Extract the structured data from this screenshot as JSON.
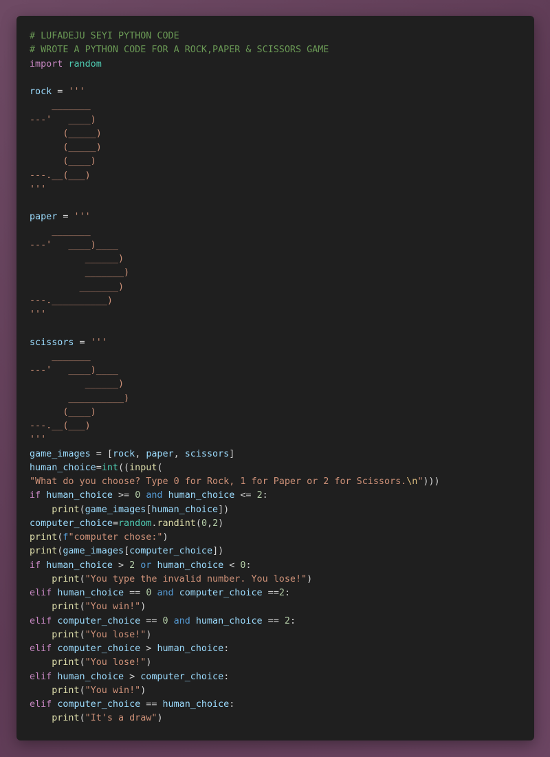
{
  "colors": {
    "background": "#6e4a64",
    "editor": "#1f1f1f",
    "comment": "#6a9955",
    "keyword": "#c586c0",
    "module": "#4ec9b0",
    "variable": "#9cdcfe",
    "string": "#ce9178",
    "number": "#b5cea8",
    "function": "#dcdcaa",
    "logic_keyword": "#569cd6"
  },
  "code": {
    "lines": [
      [
        {
          "t": "cm",
          "v": "# LUFADEJU SEYI PYTHON CODE"
        }
      ],
      [
        {
          "t": "cm",
          "v": "# WROTE A PYTHON CODE FOR A ROCK,PAPER & SCISSORS GAME"
        }
      ],
      [
        {
          "t": "kw",
          "v": "import"
        },
        {
          "t": "op",
          "v": " "
        },
        {
          "t": "mod",
          "v": "random"
        }
      ],
      [],
      [
        {
          "t": "var",
          "v": "rock"
        },
        {
          "t": "op",
          "v": " = "
        },
        {
          "t": "str",
          "v": "'''"
        }
      ],
      [
        {
          "t": "str",
          "v": "    _______"
        }
      ],
      [
        {
          "t": "str",
          "v": "---'   ____)"
        }
      ],
      [
        {
          "t": "str",
          "v": "      (_____)"
        }
      ],
      [
        {
          "t": "str",
          "v": "      (_____)"
        }
      ],
      [
        {
          "t": "str",
          "v": "      (____)"
        }
      ],
      [
        {
          "t": "str",
          "v": "---.__(___)"
        }
      ],
      [
        {
          "t": "str",
          "v": "'''"
        }
      ],
      [],
      [
        {
          "t": "var",
          "v": "paper"
        },
        {
          "t": "op",
          "v": " = "
        },
        {
          "t": "str",
          "v": "'''"
        }
      ],
      [
        {
          "t": "str",
          "v": "    _______"
        }
      ],
      [
        {
          "t": "str",
          "v": "---'   ____)____"
        }
      ],
      [
        {
          "t": "str",
          "v": "          ______)"
        }
      ],
      [
        {
          "t": "str",
          "v": "          _______)"
        }
      ],
      [
        {
          "t": "str",
          "v": "         _______)"
        }
      ],
      [
        {
          "t": "str",
          "v": "---.__________)"
        }
      ],
      [
        {
          "t": "str",
          "v": "'''"
        }
      ],
      [],
      [
        {
          "t": "var",
          "v": "scissors"
        },
        {
          "t": "op",
          "v": " = "
        },
        {
          "t": "str",
          "v": "'''"
        }
      ],
      [
        {
          "t": "str",
          "v": "    _______"
        }
      ],
      [
        {
          "t": "str",
          "v": "---'   ____)____"
        }
      ],
      [
        {
          "t": "str",
          "v": "          ______)"
        }
      ],
      [
        {
          "t": "str",
          "v": "       __________)"
        }
      ],
      [
        {
          "t": "str",
          "v": "      (____)"
        }
      ],
      [
        {
          "t": "str",
          "v": "---.__(___)"
        }
      ],
      [
        {
          "t": "str",
          "v": "'''"
        }
      ],
      [
        {
          "t": "var",
          "v": "game_images"
        },
        {
          "t": "op",
          "v": " = ["
        },
        {
          "t": "var",
          "v": "rock"
        },
        {
          "t": "op",
          "v": ", "
        },
        {
          "t": "var",
          "v": "paper"
        },
        {
          "t": "op",
          "v": ", "
        },
        {
          "t": "var",
          "v": "scissors"
        },
        {
          "t": "op",
          "v": "]"
        }
      ],
      [
        {
          "t": "var",
          "v": "human_choice"
        },
        {
          "t": "op",
          "v": "="
        },
        {
          "t": "mod",
          "v": "int"
        },
        {
          "t": "op",
          "v": "(("
        },
        {
          "t": "fn",
          "v": "input"
        },
        {
          "t": "op",
          "v": "("
        }
      ],
      [
        {
          "t": "str",
          "v": "\"What do you choose? Type 0 for Rock, 1 for Paper or 2 for Scissors."
        },
        {
          "t": "esc",
          "v": "\\n"
        },
        {
          "t": "str",
          "v": "\""
        },
        {
          "t": "op",
          "v": ")))"
        }
      ],
      [
        {
          "t": "kw",
          "v": "if"
        },
        {
          "t": "op",
          "v": " "
        },
        {
          "t": "var",
          "v": "human_choice"
        },
        {
          "t": "op",
          "v": " >= "
        },
        {
          "t": "num",
          "v": "0"
        },
        {
          "t": "op",
          "v": " "
        },
        {
          "t": "bk",
          "v": "and"
        },
        {
          "t": "op",
          "v": " "
        },
        {
          "t": "var",
          "v": "human_choice"
        },
        {
          "t": "op",
          "v": " <= "
        },
        {
          "t": "num",
          "v": "2"
        },
        {
          "t": "op",
          "v": ":"
        }
      ],
      [
        {
          "t": "op",
          "v": "    "
        },
        {
          "t": "fn",
          "v": "print"
        },
        {
          "t": "op",
          "v": "("
        },
        {
          "t": "var",
          "v": "game_images"
        },
        {
          "t": "op",
          "v": "["
        },
        {
          "t": "var",
          "v": "human_choice"
        },
        {
          "t": "op",
          "v": "])"
        }
      ],
      [
        {
          "t": "var",
          "v": "computer_choice"
        },
        {
          "t": "op",
          "v": "="
        },
        {
          "t": "mod",
          "v": "random"
        },
        {
          "t": "op",
          "v": "."
        },
        {
          "t": "fn",
          "v": "randint"
        },
        {
          "t": "op",
          "v": "("
        },
        {
          "t": "num",
          "v": "0"
        },
        {
          "t": "op",
          "v": ","
        },
        {
          "t": "num",
          "v": "2"
        },
        {
          "t": "op",
          "v": ")"
        }
      ],
      [
        {
          "t": "fn",
          "v": "print"
        },
        {
          "t": "op",
          "v": "("
        },
        {
          "t": "bk",
          "v": "f"
        },
        {
          "t": "str",
          "v": "\"computer chose:\""
        },
        {
          "t": "op",
          "v": ")"
        }
      ],
      [
        {
          "t": "fn",
          "v": "print"
        },
        {
          "t": "op",
          "v": "("
        },
        {
          "t": "var",
          "v": "game_images"
        },
        {
          "t": "op",
          "v": "["
        },
        {
          "t": "var",
          "v": "computer_choice"
        },
        {
          "t": "op",
          "v": "])"
        }
      ],
      [
        {
          "t": "kw",
          "v": "if"
        },
        {
          "t": "op",
          "v": " "
        },
        {
          "t": "var",
          "v": "human_choice"
        },
        {
          "t": "op",
          "v": " > "
        },
        {
          "t": "num",
          "v": "2"
        },
        {
          "t": "op",
          "v": " "
        },
        {
          "t": "bk",
          "v": "or"
        },
        {
          "t": "op",
          "v": " "
        },
        {
          "t": "var",
          "v": "human_choice"
        },
        {
          "t": "op",
          "v": " < "
        },
        {
          "t": "num",
          "v": "0"
        },
        {
          "t": "op",
          "v": ":"
        }
      ],
      [
        {
          "t": "op",
          "v": "    "
        },
        {
          "t": "fn",
          "v": "print"
        },
        {
          "t": "op",
          "v": "("
        },
        {
          "t": "str",
          "v": "\"You type the invalid number. You lose!\""
        },
        {
          "t": "op",
          "v": ")"
        }
      ],
      [
        {
          "t": "kw",
          "v": "elif"
        },
        {
          "t": "op",
          "v": " "
        },
        {
          "t": "var",
          "v": "human_choice"
        },
        {
          "t": "op",
          "v": " == "
        },
        {
          "t": "num",
          "v": "0"
        },
        {
          "t": "op",
          "v": " "
        },
        {
          "t": "bk",
          "v": "and"
        },
        {
          "t": "op",
          "v": " "
        },
        {
          "t": "var",
          "v": "computer_choice"
        },
        {
          "t": "op",
          "v": " =="
        },
        {
          "t": "num",
          "v": "2"
        },
        {
          "t": "op",
          "v": ":"
        }
      ],
      [
        {
          "t": "op",
          "v": "    "
        },
        {
          "t": "fn",
          "v": "print"
        },
        {
          "t": "op",
          "v": "("
        },
        {
          "t": "str",
          "v": "\"You win!\""
        },
        {
          "t": "op",
          "v": ")"
        }
      ],
      [
        {
          "t": "kw",
          "v": "elif"
        },
        {
          "t": "op",
          "v": " "
        },
        {
          "t": "var",
          "v": "computer_choice"
        },
        {
          "t": "op",
          "v": " == "
        },
        {
          "t": "num",
          "v": "0"
        },
        {
          "t": "op",
          "v": " "
        },
        {
          "t": "bk",
          "v": "and"
        },
        {
          "t": "op",
          "v": " "
        },
        {
          "t": "var",
          "v": "human_choice"
        },
        {
          "t": "op",
          "v": " == "
        },
        {
          "t": "num",
          "v": "2"
        },
        {
          "t": "op",
          "v": ":"
        }
      ],
      [
        {
          "t": "op",
          "v": "    "
        },
        {
          "t": "fn",
          "v": "print"
        },
        {
          "t": "op",
          "v": "("
        },
        {
          "t": "str",
          "v": "\"You lose!\""
        },
        {
          "t": "op",
          "v": ")"
        }
      ],
      [
        {
          "t": "kw",
          "v": "elif"
        },
        {
          "t": "op",
          "v": " "
        },
        {
          "t": "var",
          "v": "computer_choice"
        },
        {
          "t": "op",
          "v": " > "
        },
        {
          "t": "var",
          "v": "human_choice"
        },
        {
          "t": "op",
          "v": ":"
        }
      ],
      [
        {
          "t": "op",
          "v": "    "
        },
        {
          "t": "fn",
          "v": "print"
        },
        {
          "t": "op",
          "v": "("
        },
        {
          "t": "str",
          "v": "\"You lose!\""
        },
        {
          "t": "op",
          "v": ")"
        }
      ],
      [
        {
          "t": "kw",
          "v": "elif"
        },
        {
          "t": "op",
          "v": " "
        },
        {
          "t": "var",
          "v": "human_choice"
        },
        {
          "t": "op",
          "v": " > "
        },
        {
          "t": "var",
          "v": "computer_choice"
        },
        {
          "t": "op",
          "v": ":"
        }
      ],
      [
        {
          "t": "op",
          "v": "    "
        },
        {
          "t": "fn",
          "v": "print"
        },
        {
          "t": "op",
          "v": "("
        },
        {
          "t": "str",
          "v": "\"You win!\""
        },
        {
          "t": "op",
          "v": ")"
        }
      ],
      [
        {
          "t": "kw",
          "v": "elif"
        },
        {
          "t": "op",
          "v": " "
        },
        {
          "t": "var",
          "v": "computer_choice"
        },
        {
          "t": "op",
          "v": " == "
        },
        {
          "t": "var",
          "v": "human_choice"
        },
        {
          "t": "op",
          "v": ":"
        }
      ],
      [
        {
          "t": "op",
          "v": "    "
        },
        {
          "t": "fn",
          "v": "print"
        },
        {
          "t": "op",
          "v": "("
        },
        {
          "t": "str",
          "v": "\"It's a draw\""
        },
        {
          "t": "op",
          "v": ")"
        }
      ]
    ]
  }
}
